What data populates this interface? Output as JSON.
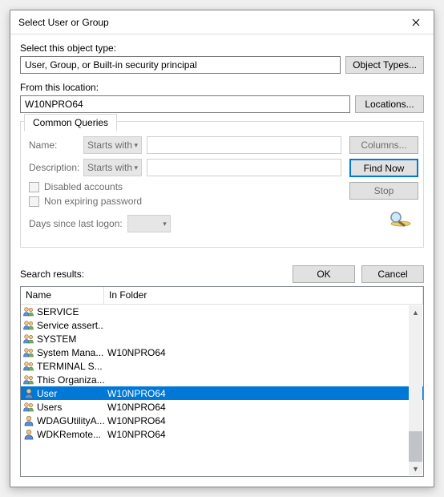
{
  "dialog": {
    "title": "Select User or Group",
    "object_type_label": "Select this object type:",
    "object_type_value": "User, Group, or Built-in security principal",
    "object_types_button": "Object Types...",
    "location_label": "From this location:",
    "location_value": "W10NPRO64",
    "locations_button": "Locations...",
    "common_queries_tab": "Common Queries",
    "name_label": "Name:",
    "name_combo": "Starts with",
    "description_label": "Description:",
    "description_combo": "Starts with",
    "disabled_accounts_label": "Disabled accounts",
    "non_expiring_label": "Non expiring password",
    "days_label": "Days since last logon:",
    "columns_button": "Columns...",
    "findnow_button": "Find Now",
    "stop_button": "Stop",
    "ok_button": "OK",
    "cancel_button": "Cancel",
    "search_results_label": "Search results:",
    "col_name": "Name",
    "col_folder": "In Folder"
  },
  "results": [
    {
      "icon": "group",
      "name": "SERVICE",
      "folder": "",
      "selected": false
    },
    {
      "icon": "group",
      "name": "Service assert...",
      "folder": "",
      "selected": false
    },
    {
      "icon": "group",
      "name": "SYSTEM",
      "folder": "",
      "selected": false
    },
    {
      "icon": "group",
      "name": "System Mana...",
      "folder": "W10NPRO64",
      "selected": false
    },
    {
      "icon": "group",
      "name": "TERMINAL S...",
      "folder": "",
      "selected": false
    },
    {
      "icon": "group",
      "name": "This Organiza...",
      "folder": "",
      "selected": false
    },
    {
      "icon": "user",
      "name": "User",
      "folder": "W10NPRO64",
      "selected": true
    },
    {
      "icon": "group",
      "name": "Users",
      "folder": "W10NPRO64",
      "selected": false
    },
    {
      "icon": "user",
      "name": "WDAGUtilityA...",
      "folder": "W10NPRO64",
      "selected": false
    },
    {
      "icon": "user",
      "name": "WDKRemote...",
      "folder": "W10NPRO64",
      "selected": false
    }
  ]
}
